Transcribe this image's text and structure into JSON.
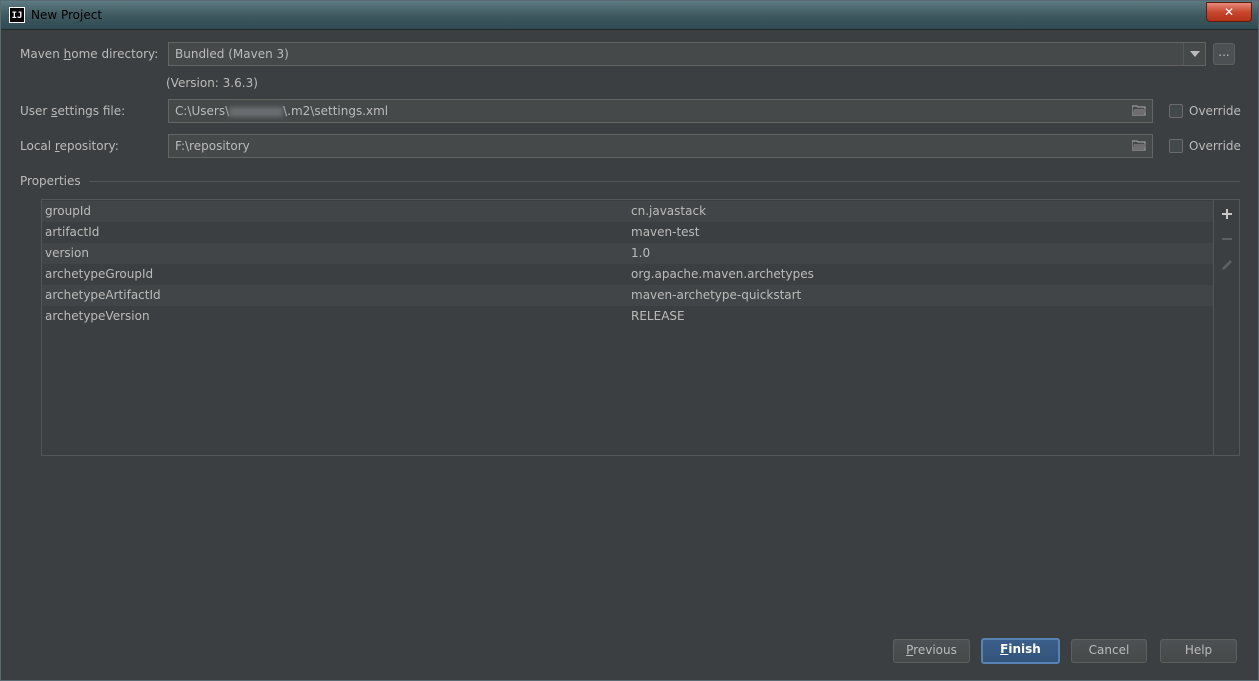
{
  "window": {
    "title": "New Project",
    "app_icon": "IJ",
    "close_label": "✕"
  },
  "maven": {
    "home_label_pre": "Maven ",
    "home_label_mnemonic": "h",
    "home_label_post": "ome directory:",
    "home_value": "Bundled (Maven 3)",
    "browse_label": "...",
    "version_text": "(Version: 3.6.3)"
  },
  "user_settings": {
    "label_pre": "User ",
    "label_mnemonic": "s",
    "label_post": "ettings file:",
    "value_pre": "C:\\Users\\",
    "value_post": "\\.m2\\settings.xml",
    "override_label": "Override",
    "override_checked": false
  },
  "local_repo": {
    "label_pre": "Local ",
    "label_mnemonic": "r",
    "label_post": "epository:",
    "value": "F:\\repository",
    "override_label": "Override",
    "override_checked": false
  },
  "properties": {
    "section_label": "Properties",
    "rows": [
      {
        "key": "groupId",
        "value": "cn.javastack"
      },
      {
        "key": "artifactId",
        "value": "maven-test"
      },
      {
        "key": "version",
        "value": "1.0"
      },
      {
        "key": "archetypeGroupId",
        "value": "org.apache.maven.archetypes"
      },
      {
        "key": "archetypeArtifactId",
        "value": "maven-archetype-quickstart"
      },
      {
        "key": "archetypeVersion",
        "value": "RELEASE"
      }
    ]
  },
  "buttons": {
    "previous_mnemonic": "P",
    "previous_rest": "revious",
    "finish_mnemonic": "F",
    "finish_rest": "inish",
    "cancel": "Cancel",
    "help": "Help"
  },
  "icons": {
    "add": "plus-icon",
    "remove": "minus-icon",
    "edit": "pencil-icon",
    "folder": "folder-icon"
  }
}
